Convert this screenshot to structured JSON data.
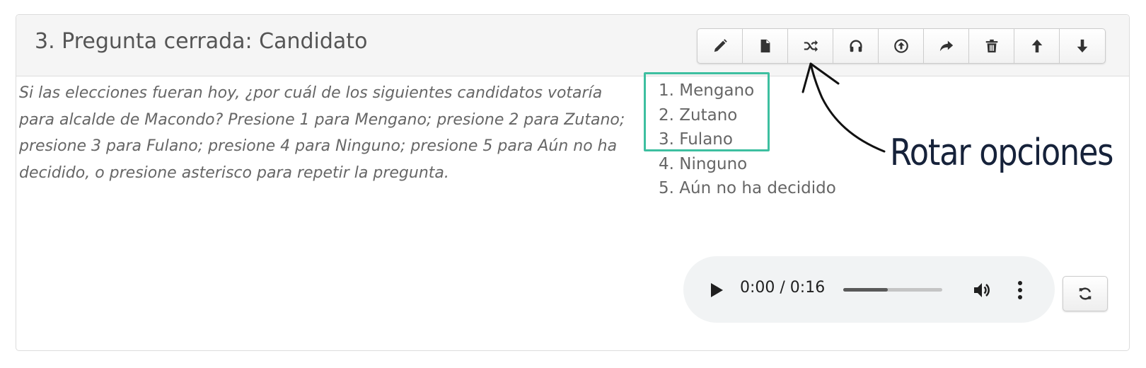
{
  "panel": {
    "title": "3. Pregunta cerrada: Candidato"
  },
  "toolbar": {
    "buttons": [
      {
        "icon": "pencil-icon",
        "name": "edit"
      },
      {
        "icon": "document-icon",
        "name": "file"
      },
      {
        "icon": "shuffle-icon",
        "name": "shuffle"
      },
      {
        "icon": "headphones-icon",
        "name": "audio"
      },
      {
        "icon": "upload-icon",
        "name": "upload"
      },
      {
        "icon": "share-icon",
        "name": "forward"
      },
      {
        "icon": "trash-icon",
        "name": "delete"
      },
      {
        "icon": "arrow-up-icon",
        "name": "move-up"
      },
      {
        "icon": "arrow-down-icon",
        "name": "move-down"
      }
    ]
  },
  "question": {
    "text": "Si las elecciones fueran hoy, ¿por cuál de los siguientes candidatos votaría para alcalde de Macondo? Presione 1 para Mengano; presione 2 para Zutano; presione 3 para Fulano; presione 4 para Ninguno; presione 5 para Aún no ha decidido, o presione asterisco para repetir la pregunta."
  },
  "options": [
    "1. Mengano",
    "2. Zutano",
    "3. Fulano",
    "4. Ninguno",
    "5. Aún no ha decidido"
  ],
  "annotation": {
    "label": "Rotar opciones",
    "color": "#16223a",
    "highlight_color": "#3dbfa0"
  },
  "audio": {
    "time_display": "0:00 / 0:16",
    "progress": 0.45
  }
}
